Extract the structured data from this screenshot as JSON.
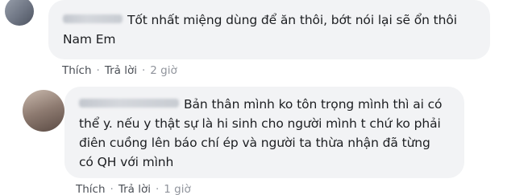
{
  "comments": [
    {
      "text": "Tốt nhất miệng dùng để ăn thôi, bớt nói lại sẽ ổn thôi Nam Em",
      "like_label": "Thích",
      "reply_label": "Trả lời",
      "separator": "·",
      "time": "2 giờ"
    },
    {
      "text": "Bản thân mình ko tôn trọng mình thì ai có thể y. nếu y thật sự là hi sinh cho người mình t chứ ko phải điên cuồng lên báo chí ép và người ta thừa nhận đã từng có QH với mình",
      "like_label": "Thích",
      "reply_label": "Trả lời",
      "separator": "·",
      "time": "1 giờ"
    }
  ]
}
